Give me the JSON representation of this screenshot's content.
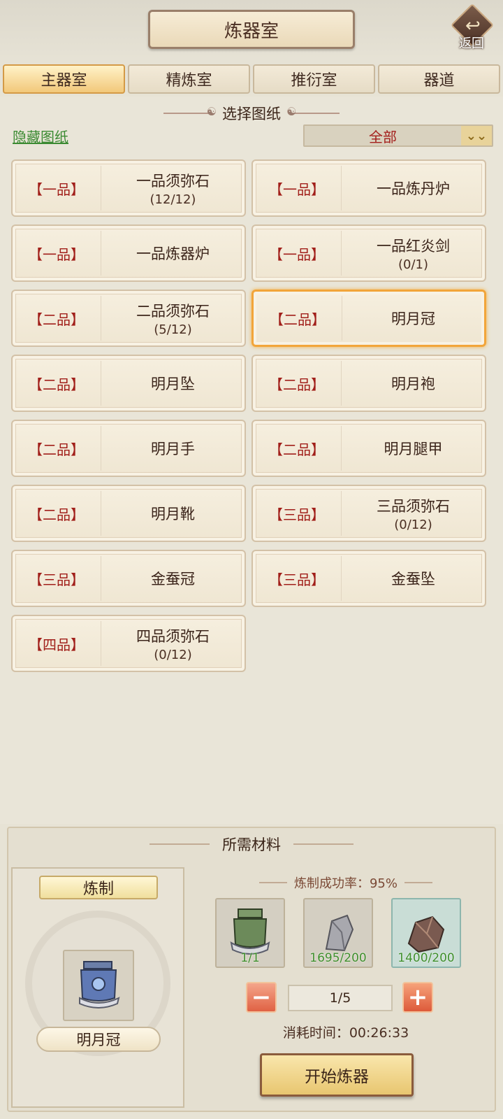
{
  "header": {
    "title": "炼器室",
    "back_label": "返回"
  },
  "tabs": [
    {
      "label": "主器室",
      "active": true
    },
    {
      "label": "精炼室",
      "active": false
    },
    {
      "label": "推衍室",
      "active": false
    },
    {
      "label": "器道",
      "active": false
    }
  ],
  "blueprints": {
    "section_title": "选择图纸",
    "hide_link": "隐藏图纸",
    "filter_value": "全部",
    "items": [
      {
        "grade": "【一品】",
        "name": "一品须弥石",
        "count": "(12/12)"
      },
      {
        "grade": "【一品】",
        "name": "一品炼丹炉",
        "count": ""
      },
      {
        "grade": "【一品】",
        "name": "一品炼器炉",
        "count": ""
      },
      {
        "grade": "【一品】",
        "name": "一品红炎剑",
        "count": "(0/1)"
      },
      {
        "grade": "【二品】",
        "name": "二品须弥石",
        "count": "(5/12)"
      },
      {
        "grade": "【二品】",
        "name": "明月冠",
        "count": "",
        "selected": true
      },
      {
        "grade": "【二品】",
        "name": "明月坠",
        "count": ""
      },
      {
        "grade": "【二品】",
        "name": "明月袍",
        "count": ""
      },
      {
        "grade": "【二品】",
        "name": "明月手",
        "count": ""
      },
      {
        "grade": "【二品】",
        "name": "明月腿甲",
        "count": ""
      },
      {
        "grade": "【二品】",
        "name": "明月靴",
        "count": ""
      },
      {
        "grade": "【三品】",
        "name": "三品须弥石",
        "count": "(0/12)"
      },
      {
        "grade": "【三品】",
        "name": "金蚕冠",
        "count": ""
      },
      {
        "grade": "【三品】",
        "name": "金蚕坠",
        "count": ""
      },
      {
        "grade": "【四品】",
        "name": "四品须弥石",
        "count": "(0/12)"
      }
    ]
  },
  "materials": {
    "section_title": "所需材料",
    "craft_label": "炼制",
    "item_name": "明月冠",
    "item_icon": "crown-helmet-icon",
    "success_rate": "炼制成功率：95%",
    "slots": [
      {
        "icon": "green-helmet-icon",
        "qty": "1/1"
      },
      {
        "icon": "grey-stone-icon",
        "qty": "1695/200"
      },
      {
        "icon": "brown-ore-icon",
        "qty": "1400/200",
        "rare": true
      }
    ],
    "quantity": "1/5",
    "time_label": "消耗时间：",
    "time_value": "00:26:33",
    "start_button": "开始炼器"
  }
}
